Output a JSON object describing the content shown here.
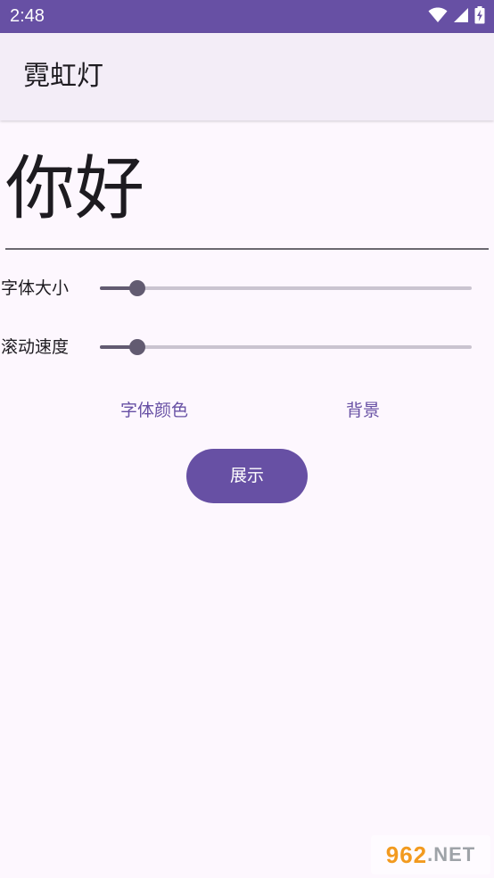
{
  "status_bar": {
    "time": "2:48",
    "icons": [
      "wifi-icon",
      "cell-signal-icon",
      "battery-charging-icon"
    ]
  },
  "app_bar": {
    "title": "霓虹灯"
  },
  "preview": {
    "text": "你好"
  },
  "sliders": [
    {
      "label": "字体大小",
      "value": 0.1
    },
    {
      "label": "滚动速度",
      "value": 0.1
    }
  ],
  "buttons": {
    "font_color_label": "字体颜色",
    "background_label": "背景",
    "show_label": "展示"
  },
  "watermark": {
    "text": "962",
    "suffix": ".NET"
  },
  "colors": {
    "primary": "#6750a4",
    "background": "#fdf7fe",
    "app_bar": "#f3edf7",
    "slider_active": "#625b71",
    "slider_inactive": "#cac4d0"
  }
}
